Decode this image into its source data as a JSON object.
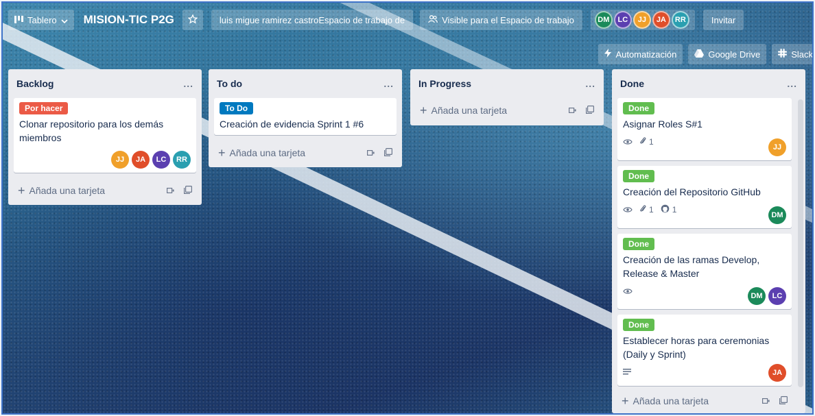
{
  "header": {
    "board_menu_label": "Tablero",
    "board_title": "MISION-TIC P2G",
    "workspace_label": "luis migue ramirez castroEspacio de trabajo de",
    "visibility_label": "Visible para el Espacio de trabajo",
    "invite_label": "Invitar",
    "automation_label": "Automatización",
    "drive_label": "Google Drive",
    "slack_label": "Slack",
    "members": [
      {
        "initials": "DM",
        "color": "#1b8a5a"
      },
      {
        "initials": "LC",
        "color": "#5b3fb0"
      },
      {
        "initials": "JJ",
        "color": "#f0a02a"
      },
      {
        "initials": "JA",
        "color": "#e04e2a"
      },
      {
        "initials": "RR",
        "color": "#2a9fb0"
      }
    ]
  },
  "add_card_label": "Añada una tarjeta",
  "colors": {
    "label_red": "#eb5a46",
    "label_blue": "#0079bf",
    "label_green": "#61bd4f"
  },
  "lists": [
    {
      "title": "Backlog",
      "menu": "...",
      "cards": [
        {
          "label": "Por hacer",
          "title": "Clonar repositorio para los demás miembros",
          "members": [
            "JJ",
            "JA",
            "LC",
            "RR"
          ]
        }
      ]
    },
    {
      "title": "To do",
      "menu": "...",
      "cards": [
        {
          "label": "To Do",
          "title": "Creación de evidencia Sprint 1 #6"
        }
      ]
    },
    {
      "title": "In Progress",
      "menu": "...",
      "cards": []
    },
    {
      "title": "Done",
      "menu": "...",
      "cards": [
        {
          "label": "Done",
          "title": "Asignar Roles S#1",
          "attachments": "1",
          "members": [
            "JJ"
          ]
        },
        {
          "label": "Done",
          "title": "Creación del Repositorio GitHub",
          "attachments": "1",
          "github": "1",
          "members": [
            "DM"
          ]
        },
        {
          "label": "Done",
          "title": "Creación de las ramas Develop, Release & Master",
          "members": [
            "DM",
            "LC"
          ]
        },
        {
          "label": "Done",
          "title": "Establecer horas para ceremonias (Daily y Sprint)",
          "members": [
            "JA"
          ]
        }
      ]
    }
  ]
}
